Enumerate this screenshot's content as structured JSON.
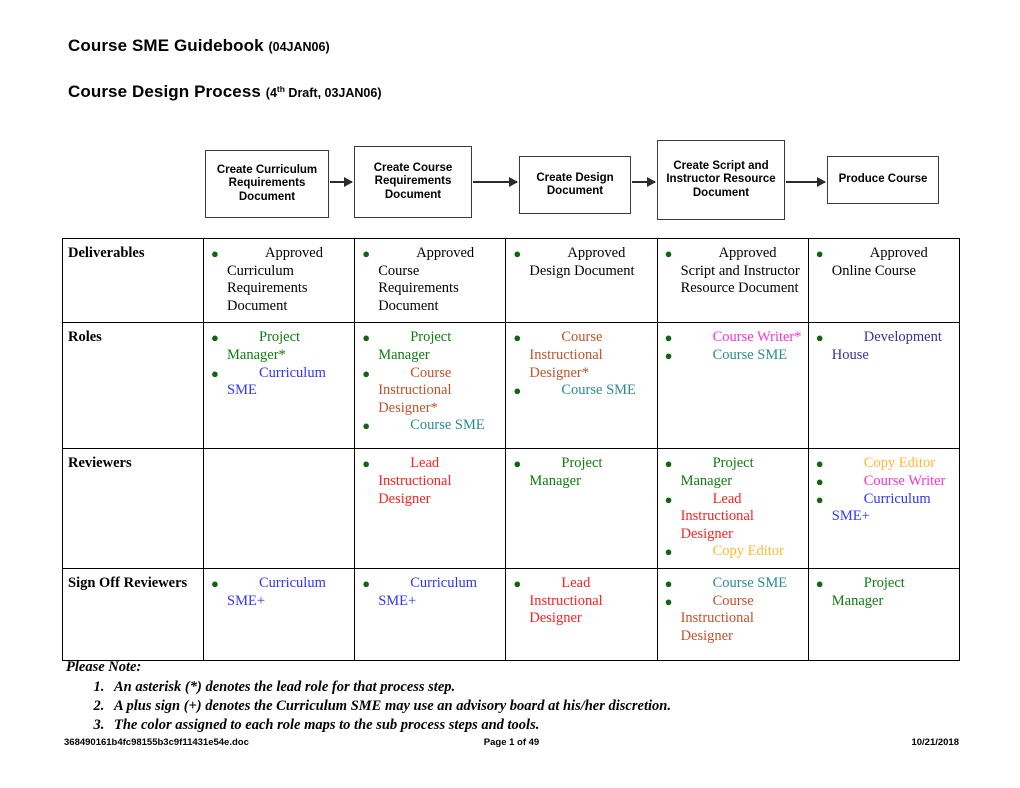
{
  "document": {
    "title_main": "Course SME Guidebook",
    "title_main_sub": "(04JAN06)",
    "title_second": "Course Design Process",
    "title_second_sub_pre": "(4",
    "title_second_sup": "th",
    "title_second_sub_post": " Draft, 03JAN06)"
  },
  "flow": {
    "steps": [
      {
        "label": "Create Curriculum Requirements Document"
      },
      {
        "label": "Create Course Requirements Document"
      },
      {
        "label": "Create Design Document"
      },
      {
        "label": "Create Script and Instructor Resource Document"
      },
      {
        "label": "Produce Course"
      }
    ]
  },
  "colors": {
    "project_manager": "#107A10",
    "curriculum_sme": "#3333FF",
    "course_instructional_designer": "#C0522B",
    "course_sme": "#2A8C8C",
    "course_writer": "#FF33CC",
    "lead_instructional_designer": "#FF2020",
    "copy_editor": "#FFB833",
    "development_house": "#333399",
    "bullet": "#106610"
  },
  "table": {
    "rows": [
      {
        "label": "Deliverables",
        "cells": [
          {
            "items": [
              {
                "text": "Approved Curriculum Requirements Document",
                "color": "#000000"
              }
            ]
          },
          {
            "items": [
              {
                "text": "Approved Course Requirements Document",
                "color": "#000000"
              }
            ]
          },
          {
            "items": [
              {
                "text": "Approved Design Document",
                "color": "#000000"
              }
            ]
          },
          {
            "items": [
              {
                "text": "Approved Script and Instructor Resource Document",
                "color": "#000000"
              }
            ]
          },
          {
            "items": [
              {
                "text": "Approved Online Course",
                "color": "#000000"
              }
            ]
          }
        ]
      },
      {
        "label": "Roles",
        "cells": [
          {
            "items": [
              {
                "text": "Project Manager*",
                "color": "#107A10"
              },
              {
                "text": "Curriculum SME",
                "color": "#3333FF"
              }
            ]
          },
          {
            "items": [
              {
                "text": "Project Manager",
                "color": "#107A10"
              },
              {
                "text": "Course Instructional Designer*",
                "color": "#C0522B"
              },
              {
                "text": "Course SME",
                "color": "#2A8C8C"
              }
            ]
          },
          {
            "items": [
              {
                "text": "Course Instructional Designer*",
                "color": "#C0522B"
              },
              {
                "text": "Course SME",
                "color": "#2A8C8C"
              }
            ]
          },
          {
            "items": [
              {
                "text": "Course Writer*",
                "color": "#FF33CC"
              },
              {
                "text": "Course SME",
                "color": "#2A8C8C"
              }
            ]
          },
          {
            "items": [
              {
                "text": "Development House",
                "color": "#333399"
              }
            ]
          }
        ]
      },
      {
        "label": "Reviewers",
        "cells": [
          {
            "items": []
          },
          {
            "items": [
              {
                "text": "Lead Instructional Designer",
                "color": "#FF2020"
              }
            ]
          },
          {
            "items": [
              {
                "text": "Project Manager",
                "color": "#107A10"
              }
            ]
          },
          {
            "items": [
              {
                "text": "Project Manager",
                "color": "#107A10"
              },
              {
                "text": "Lead Instructional Designer",
                "color": "#FF2020"
              },
              {
                "text": "Copy Editor",
                "color": "#FFB833"
              }
            ]
          },
          {
            "items": [
              {
                "text": "Copy Editor",
                "color": "#FFB833"
              },
              {
                "text": "Course Writer",
                "color": "#FF33CC"
              },
              {
                "text": "Curriculum SME+",
                "color": "#3333FF"
              }
            ]
          }
        ]
      },
      {
        "label": "Sign Off Reviewers",
        "cells": [
          {
            "items": [
              {
                "text": "Curriculum SME+",
                "color": "#3333FF"
              }
            ]
          },
          {
            "items": [
              {
                "text": "Curriculum SME+",
                "color": "#3333FF"
              }
            ]
          },
          {
            "items": [
              {
                "text": "Lead Instructional Designer",
                "color": "#FF2020"
              }
            ]
          },
          {
            "items": [
              {
                "text": "Course SME",
                "color": "#2A8C8C"
              },
              {
                "text": "Course Instructional Designer",
                "color": "#C0522B"
              }
            ]
          },
          {
            "items": [
              {
                "text": "Project Manager",
                "color": "#107A10"
              }
            ]
          }
        ]
      }
    ]
  },
  "notes": {
    "heading": "Please Note:",
    "items": [
      "An asterisk (*) denotes the lead role for that process step.",
      "A plus sign (+) denotes the Curriculum SME may use an advisory board at his/her discretion.",
      "The color assigned to each role maps to the sub process steps and tools."
    ]
  },
  "footer": {
    "filename": "368490161b4fc98155b3c9f11431e54e.doc",
    "page": "Page 1 of 49",
    "date": "10/21/2018"
  }
}
